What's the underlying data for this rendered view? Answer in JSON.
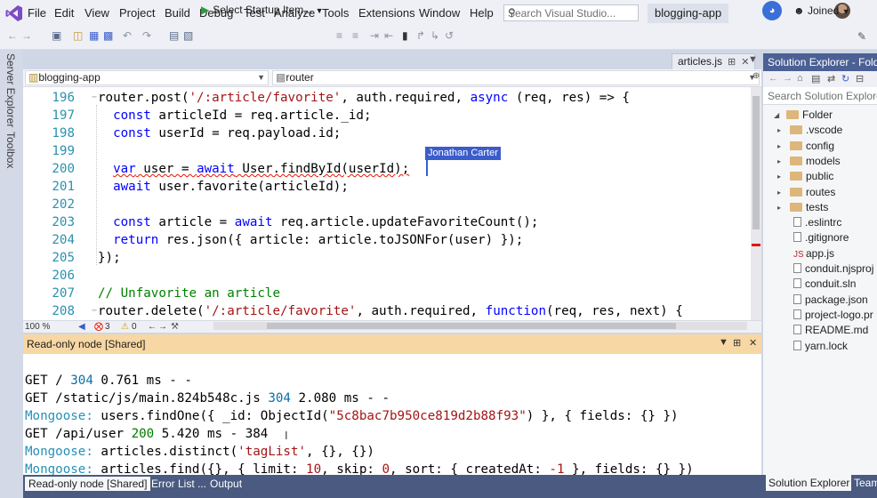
{
  "menubar": {
    "items": [
      "File",
      "Edit",
      "View",
      "Project",
      "Build",
      "Debug",
      "Test",
      "Analyze",
      "Tools",
      "Extensions",
      "Window",
      "Help"
    ],
    "search_placeholder": "Search Visual Studio...",
    "solution_name": "blogging-app"
  },
  "toolbar": {
    "startup_label": "Select Startup Item...",
    "joined_label": "Joined"
  },
  "left_strip": {
    "server_explorer": "Server Explorer",
    "toolbox": "Toolbox"
  },
  "editor": {
    "tab_name": "articles.js",
    "nav_project": "blogging-app",
    "nav_scope": "router",
    "zoom": "100 %",
    "errors": "3",
    "warnings": "0",
    "collaborator": "Jonathan Carter",
    "lines": [
      {
        "num": "196",
        "tokens": [
          [
            "router.post(",
            ""
          ],
          [
            "'/:article/favorite'",
            "str"
          ],
          [
            ", auth.required, ",
            ""
          ],
          [
            "async",
            "kw"
          ],
          [
            " (req, res) => {",
            ""
          ]
        ]
      },
      {
        "num": "197",
        "tokens": [
          [
            "  ",
            ""
          ],
          [
            "const",
            "kw"
          ],
          [
            " articleId = req.article._id;",
            ""
          ]
        ]
      },
      {
        "num": "198",
        "tokens": [
          [
            "  ",
            ""
          ],
          [
            "const",
            "kw"
          ],
          [
            " userId = req.payload.id;",
            ""
          ]
        ]
      },
      {
        "num": "199",
        "tokens": []
      },
      {
        "num": "200",
        "tokens": [
          [
            "  ",
            ""
          ],
          [
            "var user = await User.findById(userId);",
            "squig-mixed"
          ]
        ]
      },
      {
        "num": "201",
        "tokens": [
          [
            "  ",
            ""
          ],
          [
            "await",
            "kw"
          ],
          [
            " user.favorite(articleId);",
            ""
          ]
        ]
      },
      {
        "num": "202",
        "tokens": []
      },
      {
        "num": "203",
        "tokens": [
          [
            "  ",
            ""
          ],
          [
            "const",
            "kw"
          ],
          [
            " article = ",
            ""
          ],
          [
            "await",
            "kw"
          ],
          [
            " req.article.updateFavoriteCount();",
            ""
          ]
        ]
      },
      {
        "num": "204",
        "tokens": [
          [
            "  ",
            ""
          ],
          [
            "return",
            "kw"
          ],
          [
            " res.json({ article: article.toJSONFor(user) });",
            ""
          ]
        ]
      },
      {
        "num": "205",
        "tokens": [
          [
            "});",
            ""
          ]
        ]
      },
      {
        "num": "206",
        "tokens": []
      },
      {
        "num": "207",
        "tokens": [
          [
            "// Unfavorite an article",
            "cm"
          ]
        ]
      },
      {
        "num": "208",
        "tokens": [
          [
            "router.delete(",
            ""
          ],
          [
            "'/:article/favorite'",
            "str"
          ],
          [
            ", auth.required, ",
            ""
          ],
          [
            "function",
            "kw"
          ],
          [
            "(req, res, next) {",
            ""
          ]
        ]
      }
    ]
  },
  "terminal": {
    "title": "Read-only node [Shared]",
    "lines": [
      [
        [
          "",
          ""
        ]
      ],
      [
        [
          "GET / ",
          ""
        ],
        [
          "304",
          "num"
        ],
        [
          " 0.761 ms - -",
          ""
        ]
      ],
      [
        [
          "GET /static/js/main.824b548c.js ",
          ""
        ],
        [
          "304",
          "num"
        ],
        [
          " 2.080 ms - -",
          ""
        ]
      ],
      [
        [
          "Mongoose:",
          "mongo"
        ],
        [
          " users.findOne({ _id: ObjectId(",
          ""
        ],
        [
          "\"5c8bac7b950ce819d2b88f93\"",
          "str"
        ],
        [
          ") }, { fields: {} })",
          ""
        ]
      ],
      [
        [
          "GET /api/user ",
          ""
        ],
        [
          "200",
          "grn"
        ],
        [
          " 5.420 ms - 384",
          ""
        ]
      ],
      [
        [
          "Mongoose:",
          "mongo"
        ],
        [
          " articles.distinct(",
          ""
        ],
        [
          "'tagList'",
          "str"
        ],
        [
          ", {}, {})",
          ""
        ]
      ],
      [
        [
          "Mongoose:",
          "mongo"
        ],
        [
          " articles.find({}, { limit: ",
          ""
        ],
        [
          "10",
          "str"
        ],
        [
          ", skip: ",
          ""
        ],
        [
          "0",
          "str"
        ],
        [
          ", sort: { createdAt: ",
          ""
        ],
        [
          "-1",
          "str"
        ],
        [
          " }, fields: {} })",
          ""
        ]
      ]
    ]
  },
  "bottom_tabs": [
    "Read-only node [Shared]",
    "Error List ...",
    "Output"
  ],
  "solution_explorer": {
    "title": "Solution Explorer - Fold",
    "search_placeholder": "Search Solution Explore",
    "root": "Folder",
    "folders": [
      ".vscode",
      "config",
      "models",
      "public",
      "routes",
      "tests"
    ],
    "files": [
      {
        "name": ".eslintrc",
        "icon": "file"
      },
      {
        "name": ".gitignore",
        "icon": "file"
      },
      {
        "name": "app.js",
        "icon": "js"
      },
      {
        "name": "conduit.njsproj",
        "icon": "file"
      },
      {
        "name": "conduit.sln",
        "icon": "file"
      },
      {
        "name": "package.json",
        "icon": "file"
      },
      {
        "name": "project-logo.pr",
        "icon": "file"
      },
      {
        "name": "README.md",
        "icon": "file"
      },
      {
        "name": "yarn.lock",
        "icon": "file"
      }
    ],
    "tab_active": "Solution Explorer",
    "tab_other": "Team"
  },
  "colors": {
    "keyword": "#0000ff",
    "string": "#a31515",
    "comment": "#008000",
    "line_number": "#2b91af",
    "terminal_title_bg": "#f7d7a3",
    "collaborator": "#3b5ccc"
  }
}
